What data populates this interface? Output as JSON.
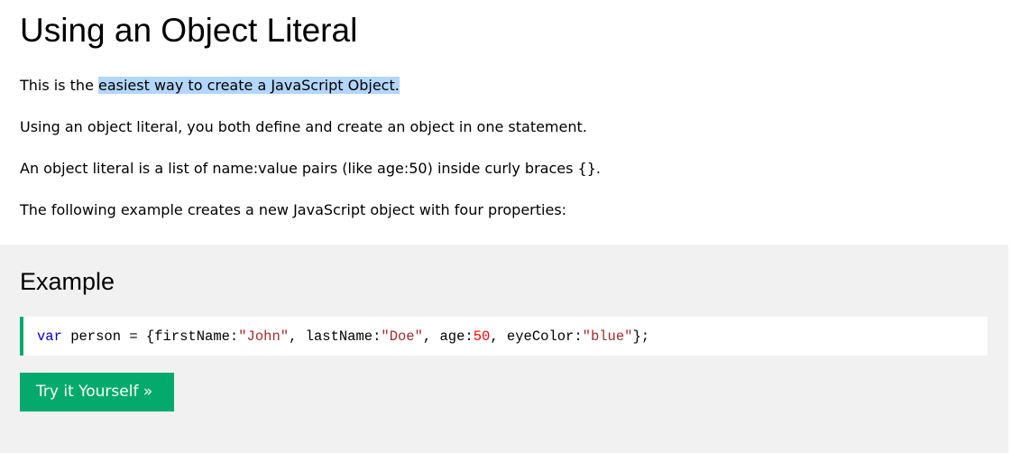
{
  "heading": "Using an Object Literal",
  "paragraphs": {
    "p1_prefix": "This is the ",
    "p1_highlight": "easiest way to create a JavaScript Object.",
    "p2": "Using an object literal, you both define and create an object in one statement.",
    "p3": "An object literal is a list of name:value pairs (like age:50) inside curly braces {}.",
    "p4": "The following example creates a new JavaScript object with four properties:"
  },
  "example": {
    "title": "Example",
    "code": {
      "keyword": "var",
      "t1": " person = {firstName:",
      "s1": "\"John\"",
      "t2": ", lastName:",
      "s2": "\"Doe\"",
      "t3": ", age:",
      "n1": "50",
      "t4": ", eyeColor:",
      "s3": "\"blue\"",
      "t5": "};"
    },
    "button_label": "Try it Yourself »"
  },
  "colors": {
    "selection_highlight": "#b3d6fb",
    "panel_background": "#f1f1f1",
    "accent_green": "#04aa6d",
    "code_keyword": "#0000cd",
    "code_string": "#a52a2a",
    "code_number": "#ff0000"
  }
}
